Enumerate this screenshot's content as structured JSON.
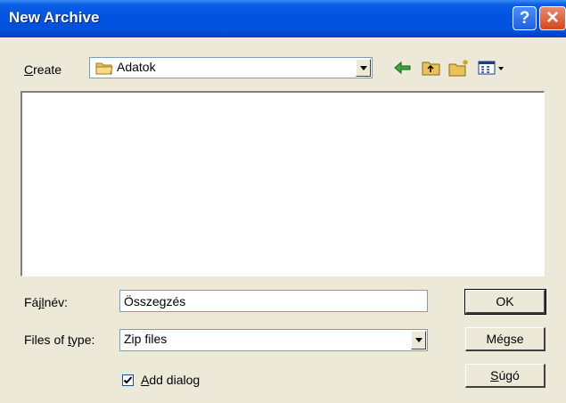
{
  "window": {
    "title": "New Archive",
    "help_glyph": "?",
    "close_glyph": "✕"
  },
  "location": {
    "label_c": "C",
    "label_rest": "reate",
    "folder_icon": "folder-icon",
    "value": "Adatok"
  },
  "toolbar": {
    "back_icon": "back-arrow-icon",
    "up_icon": "up-folder-icon",
    "new_folder_icon": "new-folder-icon",
    "views_icon": "views-menu-icon"
  },
  "form": {
    "filename_label_pre": "Fáj",
    "filename_label_u": "l",
    "filename_label_post": "név:",
    "filename_value": "Összegzés",
    "filetype_label_pre": "Files of ",
    "filetype_label_u": "t",
    "filetype_label_post": "ype:",
    "filetype_value": "Zip files",
    "checkbox_checked": true,
    "checkbox_label_u": "A",
    "checkbox_label_rest": "dd dialog"
  },
  "buttons": {
    "ok": "OK",
    "cancel": "Mégse",
    "help_u": "S",
    "help_rest": "úgó"
  },
  "colors": {
    "titlebar": "#0053E1",
    "dialog_bg": "#ECE9D8",
    "field_border": "#7F9DB9"
  }
}
